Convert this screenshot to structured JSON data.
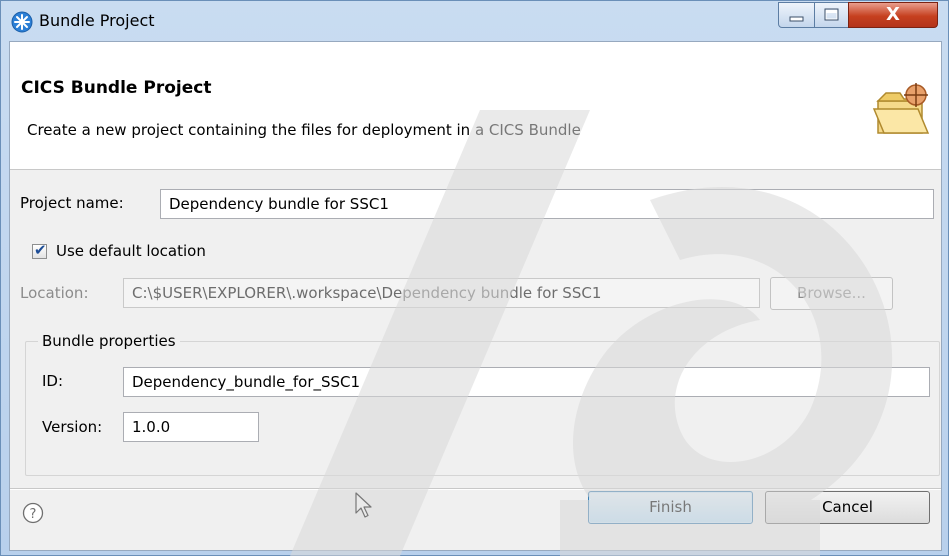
{
  "window": {
    "title": "Bundle Project",
    "controls": {
      "close_glyph": "X"
    }
  },
  "header": {
    "title": "CICS Bundle Project",
    "description": "Create a new project containing the files for deployment in a CICS Bundle"
  },
  "form": {
    "project_name_label": "Project name:",
    "project_name_value": "Dependency bundle for SSC1",
    "use_default_location_label": "Use default location",
    "use_default_location_checked": true,
    "location_label": "Location:",
    "location_value": "C:\\$USER\\EXPLORER\\.workspace\\Dependency bundle for SSC1",
    "browse_label": "Browse..."
  },
  "bundle_properties": {
    "group_title": "Bundle properties",
    "id_label": "ID:",
    "id_value": "Dependency_bundle_for_SSC1",
    "version_label": "Version:",
    "version_value": "1.0.0"
  },
  "footer": {
    "help_icon": "help-icon",
    "finish_label": "Finish",
    "cancel_label": "Cancel"
  },
  "colors": {
    "title_bar": "#c9dcf1",
    "close_button": "#c6401f",
    "default_button": "#bde0f8",
    "checkmark": "#1d4d96"
  }
}
